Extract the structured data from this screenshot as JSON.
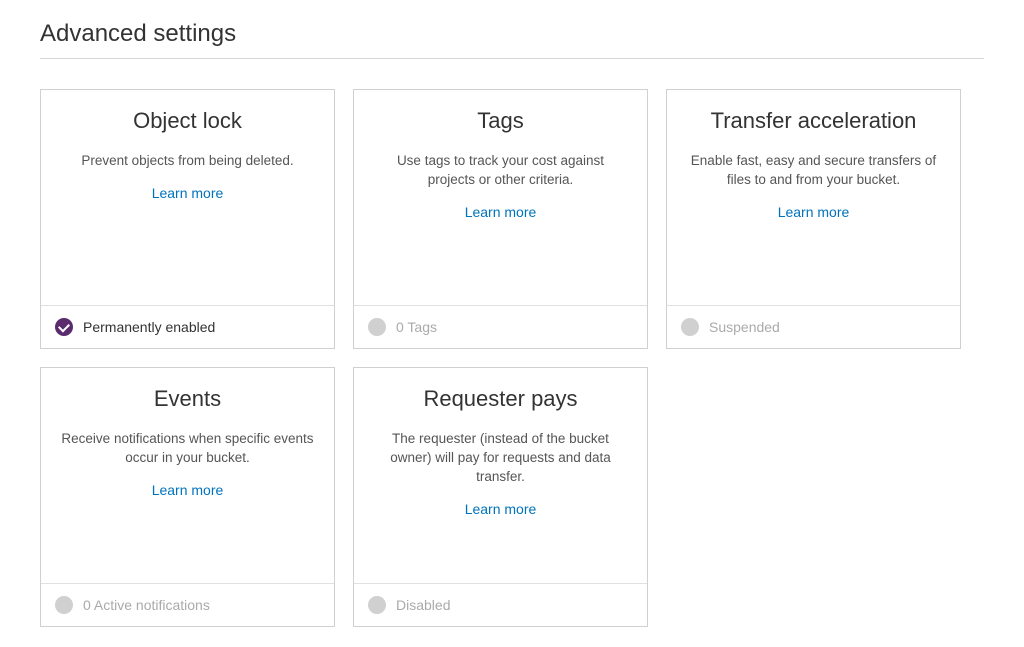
{
  "section": {
    "title": "Advanced settings"
  },
  "learn_more_label": "Learn more",
  "cards": [
    {
      "title": "Object lock",
      "desc": "Prevent objects from being deleted.",
      "status_text": "Permanently enabled",
      "status_active": true
    },
    {
      "title": "Tags",
      "desc": "Use tags to track your cost against projects or other criteria.",
      "status_text": "0 Tags",
      "status_active": false
    },
    {
      "title": "Transfer acceleration",
      "desc": "Enable fast, easy and secure transfers of files to and from your bucket.",
      "status_text": "Suspended",
      "status_active": false
    },
    {
      "title": "Events",
      "desc": "Receive notifications when specific events occur in your bucket.",
      "status_text": "0 Active notifications",
      "status_active": false
    },
    {
      "title": "Requester pays",
      "desc": "The requester (instead of the bucket owner) will pay for requests and data transfer.",
      "status_text": "Disabled",
      "status_active": false
    }
  ]
}
